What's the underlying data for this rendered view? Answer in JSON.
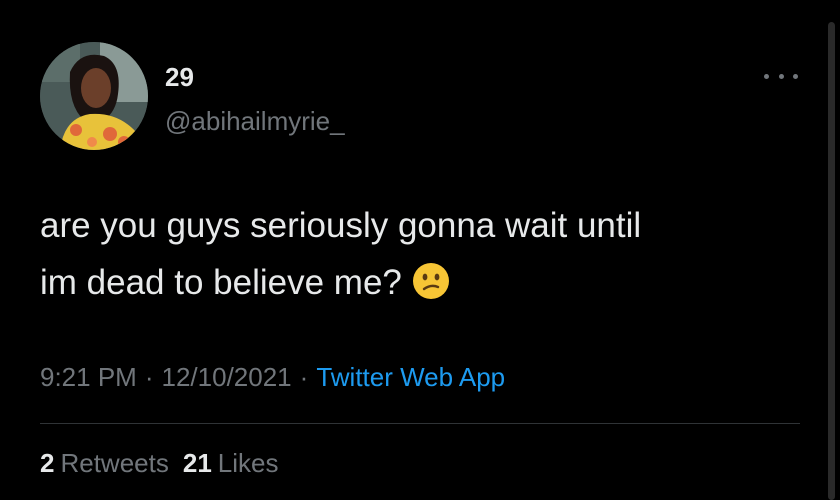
{
  "user": {
    "display_name": "29",
    "handle": "@abihailmyrie_",
    "avatar_icon": "profile-photo"
  },
  "tweet": {
    "text_line1": "are you guys seriously gonna wait until",
    "text_line2": "im dead to believe me?",
    "emoji_icon": "confused-face-emoji"
  },
  "meta": {
    "time": "9:21 PM",
    "separator": "·",
    "date": "12/10/2021",
    "source": "Twitter Web App"
  },
  "stats": {
    "retweets_count": "2",
    "retweets_label": "Retweets",
    "likes_count": "21",
    "likes_label": "Likes"
  },
  "colors": {
    "background": "#000000",
    "primary_text": "#e7e9ea",
    "secondary_text": "#71767b",
    "link": "#1d9bf0",
    "divider": "#2f3336"
  }
}
